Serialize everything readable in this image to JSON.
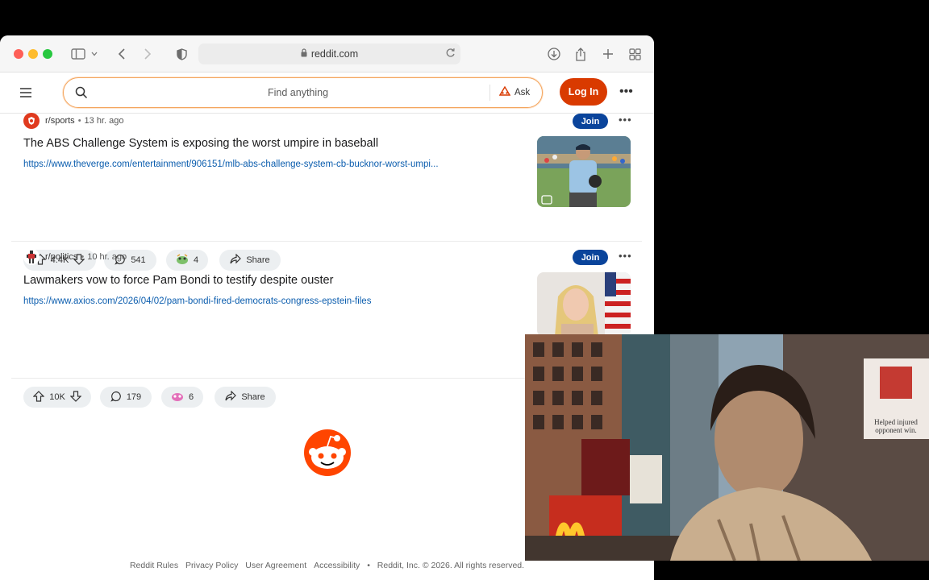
{
  "browser": {
    "url": "reddit.com",
    "icons": [
      "sidebar-icon",
      "chevron-down-icon",
      "back-icon",
      "forward-icon",
      "shield-icon",
      "lock-icon",
      "reload-icon",
      "download-icon",
      "share-icon",
      "new-tab-icon",
      "tab-overview-icon"
    ]
  },
  "header": {
    "search_placeholder": "Find anything",
    "ask_label": "Ask",
    "login_label": "Log In",
    "brand_color": "#d93a00"
  },
  "posts": [
    {
      "subreddit": "r/sports",
      "age": "13 hr. ago",
      "join_label": "Join",
      "title": "The ABS Challenge System is exposing the worst umpire in baseball",
      "link": "https://www.theverge.com/entertainment/906151/mlb-abs-challenge-system-cb-bucknor-worst-umpi...",
      "votes": "4.4K",
      "comments": "541",
      "awards": "4",
      "share_label": "Share"
    },
    {
      "subreddit": "r/politics",
      "age": "10 hr. ago",
      "join_label": "Join",
      "title": "Lawmakers vow to force Pam Bondi to testify despite ouster",
      "link": "https://www.axios.com/2026/04/02/pam-bondi-fired-democrats-congress-epstein-files",
      "votes": "10K",
      "comments": "179",
      "awards": "6",
      "share_label": "Share"
    }
  ],
  "footer": {
    "links": [
      "Reddit Rules",
      "Privacy Policy",
      "User Agreement",
      "Accessibility"
    ],
    "bullet": "•",
    "copyright": "Reddit, Inc. © 2026. All rights reserved."
  },
  "webcam": {
    "sign_text_1": "Helped injured",
    "sign_text_2": "opponent win."
  }
}
